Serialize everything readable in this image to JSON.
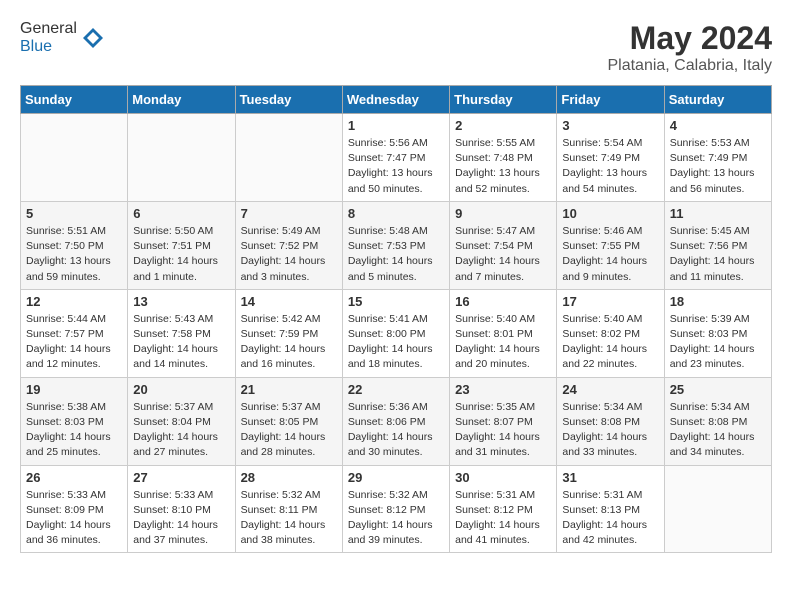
{
  "header": {
    "logo_general": "General",
    "logo_blue": "Blue",
    "month_year": "May 2024",
    "location": "Platania, Calabria, Italy"
  },
  "weekdays": [
    "Sunday",
    "Monday",
    "Tuesday",
    "Wednesday",
    "Thursday",
    "Friday",
    "Saturday"
  ],
  "weeks": [
    [
      {
        "day": "",
        "content": ""
      },
      {
        "day": "",
        "content": ""
      },
      {
        "day": "",
        "content": ""
      },
      {
        "day": "1",
        "content": "Sunrise: 5:56 AM\nSunset: 7:47 PM\nDaylight: 13 hours\nand 50 minutes."
      },
      {
        "day": "2",
        "content": "Sunrise: 5:55 AM\nSunset: 7:48 PM\nDaylight: 13 hours\nand 52 minutes."
      },
      {
        "day": "3",
        "content": "Sunrise: 5:54 AM\nSunset: 7:49 PM\nDaylight: 13 hours\nand 54 minutes."
      },
      {
        "day": "4",
        "content": "Sunrise: 5:53 AM\nSunset: 7:49 PM\nDaylight: 13 hours\nand 56 minutes."
      }
    ],
    [
      {
        "day": "5",
        "content": "Sunrise: 5:51 AM\nSunset: 7:50 PM\nDaylight: 13 hours\nand 59 minutes."
      },
      {
        "day": "6",
        "content": "Sunrise: 5:50 AM\nSunset: 7:51 PM\nDaylight: 14 hours\nand 1 minute."
      },
      {
        "day": "7",
        "content": "Sunrise: 5:49 AM\nSunset: 7:52 PM\nDaylight: 14 hours\nand 3 minutes."
      },
      {
        "day": "8",
        "content": "Sunrise: 5:48 AM\nSunset: 7:53 PM\nDaylight: 14 hours\nand 5 minutes."
      },
      {
        "day": "9",
        "content": "Sunrise: 5:47 AM\nSunset: 7:54 PM\nDaylight: 14 hours\nand 7 minutes."
      },
      {
        "day": "10",
        "content": "Sunrise: 5:46 AM\nSunset: 7:55 PM\nDaylight: 14 hours\nand 9 minutes."
      },
      {
        "day": "11",
        "content": "Sunrise: 5:45 AM\nSunset: 7:56 PM\nDaylight: 14 hours\nand 11 minutes."
      }
    ],
    [
      {
        "day": "12",
        "content": "Sunrise: 5:44 AM\nSunset: 7:57 PM\nDaylight: 14 hours\nand 12 minutes."
      },
      {
        "day": "13",
        "content": "Sunrise: 5:43 AM\nSunset: 7:58 PM\nDaylight: 14 hours\nand 14 minutes."
      },
      {
        "day": "14",
        "content": "Sunrise: 5:42 AM\nSunset: 7:59 PM\nDaylight: 14 hours\nand 16 minutes."
      },
      {
        "day": "15",
        "content": "Sunrise: 5:41 AM\nSunset: 8:00 PM\nDaylight: 14 hours\nand 18 minutes."
      },
      {
        "day": "16",
        "content": "Sunrise: 5:40 AM\nSunset: 8:01 PM\nDaylight: 14 hours\nand 20 minutes."
      },
      {
        "day": "17",
        "content": "Sunrise: 5:40 AM\nSunset: 8:02 PM\nDaylight: 14 hours\nand 22 minutes."
      },
      {
        "day": "18",
        "content": "Sunrise: 5:39 AM\nSunset: 8:03 PM\nDaylight: 14 hours\nand 23 minutes."
      }
    ],
    [
      {
        "day": "19",
        "content": "Sunrise: 5:38 AM\nSunset: 8:03 PM\nDaylight: 14 hours\nand 25 minutes."
      },
      {
        "day": "20",
        "content": "Sunrise: 5:37 AM\nSunset: 8:04 PM\nDaylight: 14 hours\nand 27 minutes."
      },
      {
        "day": "21",
        "content": "Sunrise: 5:37 AM\nSunset: 8:05 PM\nDaylight: 14 hours\nand 28 minutes."
      },
      {
        "day": "22",
        "content": "Sunrise: 5:36 AM\nSunset: 8:06 PM\nDaylight: 14 hours\nand 30 minutes."
      },
      {
        "day": "23",
        "content": "Sunrise: 5:35 AM\nSunset: 8:07 PM\nDaylight: 14 hours\nand 31 minutes."
      },
      {
        "day": "24",
        "content": "Sunrise: 5:34 AM\nSunset: 8:08 PM\nDaylight: 14 hours\nand 33 minutes."
      },
      {
        "day": "25",
        "content": "Sunrise: 5:34 AM\nSunset: 8:08 PM\nDaylight: 14 hours\nand 34 minutes."
      }
    ],
    [
      {
        "day": "26",
        "content": "Sunrise: 5:33 AM\nSunset: 8:09 PM\nDaylight: 14 hours\nand 36 minutes."
      },
      {
        "day": "27",
        "content": "Sunrise: 5:33 AM\nSunset: 8:10 PM\nDaylight: 14 hours\nand 37 minutes."
      },
      {
        "day": "28",
        "content": "Sunrise: 5:32 AM\nSunset: 8:11 PM\nDaylight: 14 hours\nand 38 minutes."
      },
      {
        "day": "29",
        "content": "Sunrise: 5:32 AM\nSunset: 8:12 PM\nDaylight: 14 hours\nand 39 minutes."
      },
      {
        "day": "30",
        "content": "Sunrise: 5:31 AM\nSunset: 8:12 PM\nDaylight: 14 hours\nand 41 minutes."
      },
      {
        "day": "31",
        "content": "Sunrise: 5:31 AM\nSunset: 8:13 PM\nDaylight: 14 hours\nand 42 minutes."
      },
      {
        "day": "",
        "content": ""
      }
    ]
  ]
}
